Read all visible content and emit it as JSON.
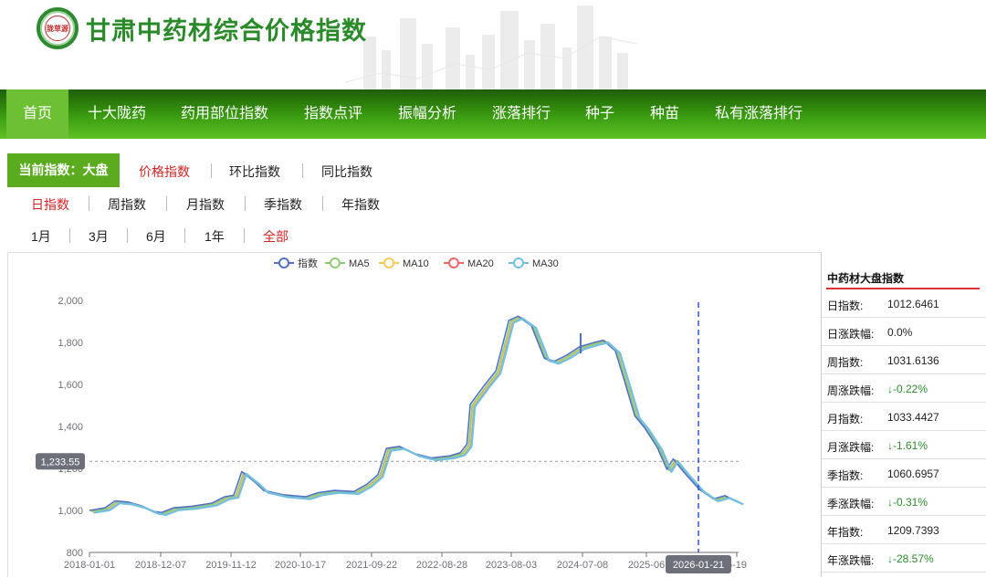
{
  "header": {
    "logo_text": "陇草源",
    "title": "甘肃中药材综合价格指数"
  },
  "nav": {
    "items": [
      "首页",
      "十大陇药",
      "药用部位指数",
      "指数点评",
      "振幅分析",
      "涨落排行",
      "种子",
      "种苗",
      "私有涨落排行"
    ],
    "active": "首页"
  },
  "filters": {
    "current_index": "当前指数：大盘",
    "types": [
      "价格指数",
      "环比指数",
      "同比指数"
    ],
    "types_active": "价格指数",
    "periods": [
      "日指数",
      "周指数",
      "月指数",
      "季指数",
      "年指数"
    ],
    "periods_active": "日指数",
    "ranges": [
      "1月",
      "3月",
      "6月",
      "1年",
      "全部"
    ],
    "ranges_active": "全部"
  },
  "chart_data": {
    "type": "line",
    "legend": [
      "指数",
      "MA5",
      "MA10",
      "MA20",
      "MA30"
    ],
    "colors": {
      "指数": "#5470c6",
      "MA5": "#91cc75",
      "MA10": "#fac858",
      "MA20": "#ee6666",
      "MA30": "#73c0de"
    },
    "ylim": [
      800,
      2000
    ],
    "yticks": [
      "800",
      "1,000",
      "1,200",
      "1,400",
      "1,600",
      "1,800",
      "2,000"
    ],
    "xticks": [
      "2018-01-01",
      "2018-12-07",
      "2019-11-12",
      "2020-10-17",
      "2021-09-22",
      "2022-08-28",
      "2023-08-03",
      "2024-07-08",
      "2025-06",
      "5-19"
    ],
    "pointer_y_label": "1,233.55",
    "pointer_x_label": "2026-01-21",
    "pointer_y_value": 1233.55,
    "pointer_x": "2026-01-21",
    "x_start": "2018-01-01",
    "x_end": "2026-05-19",
    "series": {
      "name": "指数",
      "points": [
        [
          "2018-01-01",
          1000
        ],
        [
          "2018-03-15",
          1012
        ],
        [
          "2018-05-01",
          1045
        ],
        [
          "2018-07-01",
          1040
        ],
        [
          "2018-09-01",
          1022
        ],
        [
          "2018-11-01",
          995
        ],
        [
          "2018-12-07",
          990
        ],
        [
          "2019-02-01",
          1012
        ],
        [
          "2019-05-01",
          1020
        ],
        [
          "2019-08-01",
          1035
        ],
        [
          "2019-10-01",
          1065
        ],
        [
          "2019-11-12",
          1072
        ],
        [
          "2019-12-20",
          1185
        ],
        [
          "2020-02-20",
          1135
        ],
        [
          "2020-04-01",
          1095
        ],
        [
          "2020-07-01",
          1075
        ],
        [
          "2020-10-17",
          1065
        ],
        [
          "2020-12-15",
          1085
        ],
        [
          "2021-03-01",
          1095
        ],
        [
          "2021-06-01",
          1090
        ],
        [
          "2021-08-01",
          1125
        ],
        [
          "2021-09-22",
          1170
        ],
        [
          "2021-11-01",
          1295
        ],
        [
          "2022-01-01",
          1305
        ],
        [
          "2022-03-15",
          1270
        ],
        [
          "2022-06-01",
          1250
        ],
        [
          "2022-08-28",
          1260
        ],
        [
          "2022-10-15",
          1275
        ],
        [
          "2022-11-15",
          1315
        ],
        [
          "2022-12-01",
          1505
        ],
        [
          "2023-02-01",
          1590
        ],
        [
          "2023-04-01",
          1665
        ],
        [
          "2023-06-01",
          1905
        ],
        [
          "2023-07-15",
          1925
        ],
        [
          "2023-08-03",
          1910
        ],
        [
          "2023-09-15",
          1880
        ],
        [
          "2023-11-15",
          1725
        ],
        [
          "2024-01-01",
          1710
        ],
        [
          "2024-03-01",
          1740
        ],
        [
          "2024-05-01",
          1780
        ],
        [
          "2024-07-08",
          1800
        ],
        [
          "2024-08-20",
          1810
        ],
        [
          "2024-10-15",
          1760
        ],
        [
          "2024-12-01",
          1605
        ],
        [
          "2025-01-15",
          1450
        ],
        [
          "2025-03-01",
          1395
        ],
        [
          "2025-05-01",
          1300
        ],
        [
          "2025-06-15",
          1195
        ],
        [
          "2025-07-15",
          1245
        ],
        [
          "2025-09-01",
          1185
        ],
        [
          "2025-11-15",
          1100
        ],
        [
          "2026-01-21",
          1055
        ],
        [
          "2026-03-15",
          1070
        ],
        [
          "2026-05-19",
          1040
        ]
      ]
    }
  },
  "side": {
    "title": "中药材大盘指数",
    "rows": [
      {
        "k": "日指数:",
        "v": "1012.6461",
        "down": false
      },
      {
        "k": "日涨跌幅:",
        "v": "0.0%",
        "down": false
      },
      {
        "k": "周指数:",
        "v": "1031.6136",
        "down": false
      },
      {
        "k": "周涨跌幅:",
        "v": "↓-0.22%",
        "down": true
      },
      {
        "k": "月指数:",
        "v": "1033.4427",
        "down": false
      },
      {
        "k": "月涨跌幅:",
        "v": "↓-1.61%",
        "down": true
      },
      {
        "k": "季指数:",
        "v": "1060.6957",
        "down": false
      },
      {
        "k": "季涨跌幅:",
        "v": "↓-0.31%",
        "down": true
      },
      {
        "k": "年指数:",
        "v": "1209.7393",
        "down": false
      },
      {
        "k": "年涨跌幅:",
        "v": "↓-28.57%",
        "down": true
      }
    ]
  }
}
